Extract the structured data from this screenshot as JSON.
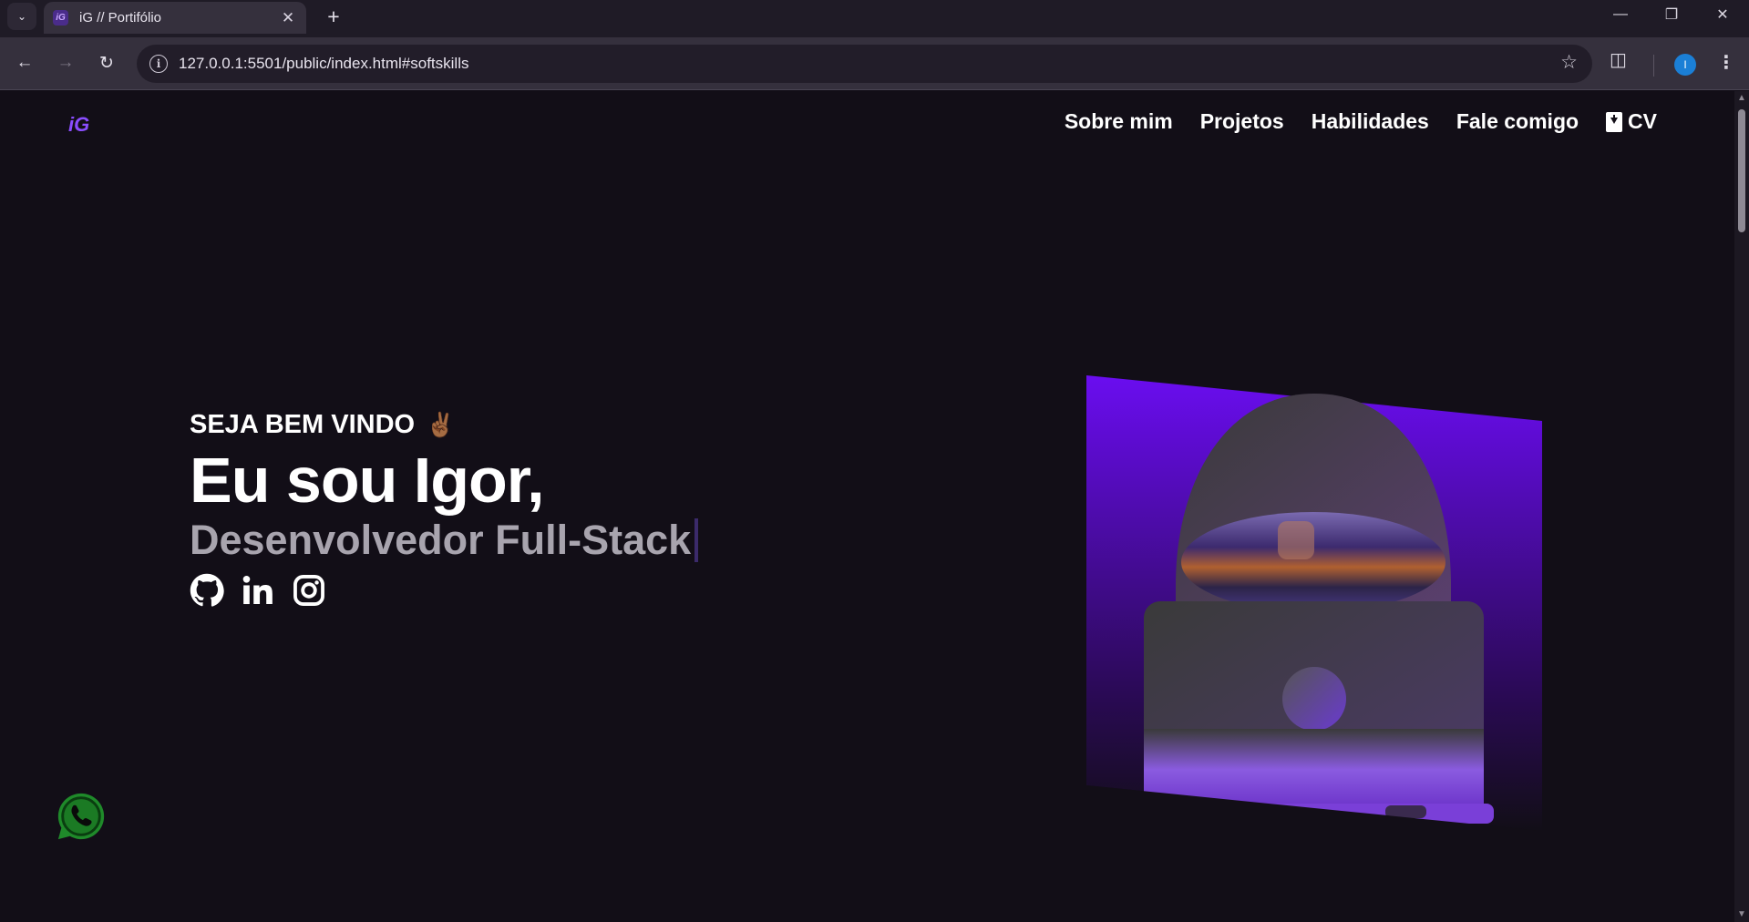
{
  "browser": {
    "tab_title": "iG // Portifólio",
    "favicon_text": "iG",
    "url": "127.0.0.1:5501/public/index.html#softskills",
    "profile_initial": "I"
  },
  "site": {
    "logo": "iG",
    "nav": [
      {
        "label": "Sobre mim"
      },
      {
        "label": "Projetos"
      },
      {
        "label": "Habilidades"
      },
      {
        "label": "Fale comigo"
      },
      {
        "label": "CV",
        "icon": "file-download-icon"
      }
    ]
  },
  "hero": {
    "greeting": "SEJA BEM VINDO",
    "greeting_emoji": "✌🏾",
    "name": "Eu sou Igor,",
    "role": "Desenvolvedor Full-Stack",
    "socials": [
      {
        "icon": "github-icon"
      },
      {
        "icon": "linkedin-icon"
      },
      {
        "icon": "instagram-icon"
      }
    ]
  },
  "floating": {
    "icon": "whatsapp-icon"
  },
  "colors": {
    "background": "#120e17",
    "accent": "#8a4dff",
    "illustration_purple": "#6a0df0",
    "whatsapp_green": "#25d366"
  }
}
